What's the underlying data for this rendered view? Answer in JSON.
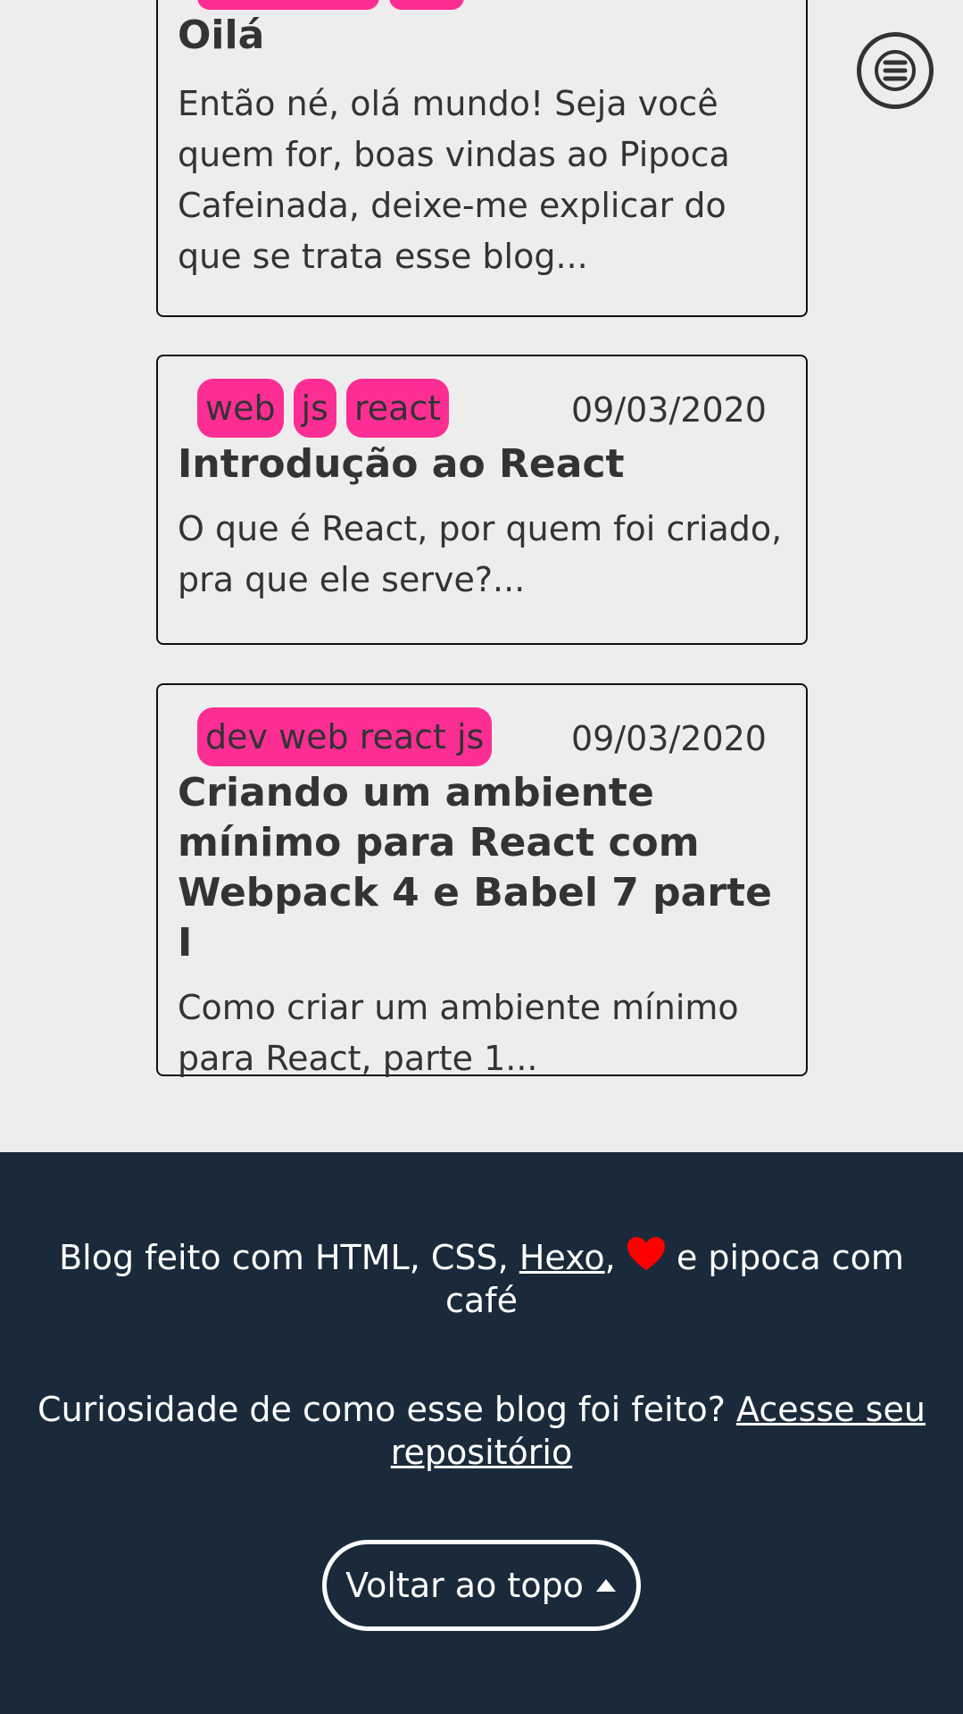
{
  "menu": {
    "icon": "hamburger-menu-icon"
  },
  "posts": [
    {
      "title": "Oilá",
      "excerpt": "Então né, olá mundo! Seja você quem for, boas vindas ao Pipoca Cafeinada, deixe-me explicar do que se trata esse blog..."
    },
    {
      "tags": [
        "web",
        "js",
        "react"
      ],
      "date": "09/03/2020",
      "title": "Introdução ao React",
      "excerpt": "O que é React, por quem foi criado, pra que ele serve?..."
    },
    {
      "tags": [
        "dev web react js"
      ],
      "date": "09/03/2020",
      "title": "Criando um ambiente mínimo para React com Webpack 4 e Babel 7 parte I",
      "excerpt": "Como criar um ambiente mínimo para React, parte 1..."
    }
  ],
  "footer": {
    "made_with_prefix": "Blog feito com HTML, CSS, ",
    "hexo_link": "Hexo",
    "comma": ",",
    "made_with_suffix": " e pipoca com café",
    "heart_icon": "heart-icon",
    "heart_color": "#ff0000",
    "curiosity_text": "Curiosidade de como esse blog foi feito? ",
    "repo_link": "Acesse seu repositório",
    "back_to_top_label": "Voltar ao topo",
    "back_to_top_icon": "caret-up-icon"
  },
  "colors": {
    "background": "#eeeded",
    "tag": "#fc2e93",
    "footer_background": "#1b2a3a",
    "text": "#333333"
  }
}
